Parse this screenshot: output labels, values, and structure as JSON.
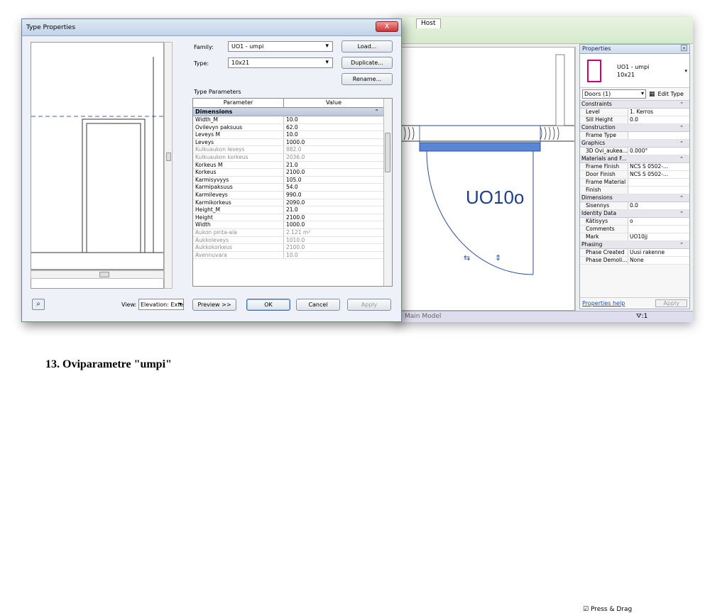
{
  "background_window": {
    "tabs": [
      "Host"
    ],
    "view_tag": "UO10o",
    "status_left": "Main Model",
    "status_right": "Press & Drag",
    "filter_count": ":1"
  },
  "properties_palette": {
    "title": "Properties",
    "type_name_line1": "UO1 - umpi",
    "type_name_line2": "10x21",
    "selector": "Doors (1)",
    "edit_type_label": "Edit Type",
    "groups": [
      {
        "name": "Constraints",
        "rows": [
          [
            "Level",
            "1. Kerros"
          ],
          [
            "Sill Height",
            "0.0"
          ]
        ]
      },
      {
        "name": "Construction",
        "rows": [
          [
            "Frame Type",
            ""
          ]
        ]
      },
      {
        "name": "Graphics",
        "rows": [
          [
            "3D Ovi_aukea...",
            "0.000°"
          ]
        ]
      },
      {
        "name": "Materials and F...",
        "rows": [
          [
            "Frame Finish",
            "NCS S 0502-..."
          ],
          [
            "Door Finish",
            "NCS S 0502-..."
          ],
          [
            "Frame Material",
            ""
          ],
          [
            "Finish",
            ""
          ]
        ]
      },
      {
        "name": "Dimensions",
        "rows": [
          [
            "Sisennys",
            "0.0"
          ]
        ]
      },
      {
        "name": "Identity Data",
        "rows": [
          [
            "Kätisyys",
            "o"
          ],
          [
            "Comments",
            ""
          ],
          [
            "Mark",
            "UO10jj"
          ]
        ]
      },
      {
        "name": "Phasing",
        "rows": [
          [
            "Phase Created",
            "Uusi rakenne"
          ],
          [
            "Phase Demoli...",
            "None"
          ]
        ]
      }
    ],
    "help_link": "Properties help",
    "apply_label": "Apply"
  },
  "dialog": {
    "title": "Type Properties",
    "close_label": "X",
    "family_label": "Family:",
    "family_value": "UO1 - umpi",
    "type_label": "Type:",
    "type_value": "10x21",
    "load_button": "Load...",
    "duplicate_button": "Duplicate...",
    "rename_button": "Rename...",
    "section_label": "Type Parameters",
    "col_parameter": "Parameter",
    "col_value": "Value",
    "group_name": "Dimensions",
    "params": [
      {
        "name": "Width_M",
        "value": "10.0",
        "readonly": false
      },
      {
        "name": "Ovilevyn paksuus",
        "value": "62.0",
        "readonly": false
      },
      {
        "name": "Leveys M",
        "value": "10.0",
        "readonly": false
      },
      {
        "name": "Leveys",
        "value": "1000.0",
        "readonly": false
      },
      {
        "name": "Kulkuaukon leveys",
        "value": "882.0",
        "readonly": true
      },
      {
        "name": "Kulkuaukon korkeus",
        "value": "2036.0",
        "readonly": true
      },
      {
        "name": "Korkeus M",
        "value": "21.0",
        "readonly": false
      },
      {
        "name": "Korkeus",
        "value": "2100.0",
        "readonly": false
      },
      {
        "name": "Karmisyvyys",
        "value": "105.0",
        "readonly": false
      },
      {
        "name": "Karmipaksuus",
        "value": "54.0",
        "readonly": false
      },
      {
        "name": "Karmileveys",
        "value": "990.0",
        "readonly": false
      },
      {
        "name": "Karmikorkeus",
        "value": "2090.0",
        "readonly": false
      },
      {
        "name": "Height_M",
        "value": "21.0",
        "readonly": false
      },
      {
        "name": "Height",
        "value": "2100.0",
        "readonly": false
      },
      {
        "name": "Width",
        "value": "1000.0",
        "readonly": false
      },
      {
        "name": "Aukon pinta-ala",
        "value": "2.121 m²",
        "readonly": true
      },
      {
        "name": "Aukkoleveys",
        "value": "1010.0",
        "readonly": true
      },
      {
        "name": "Aukkokorkeus",
        "value": "2100.0",
        "readonly": true
      },
      {
        "name": "Avennuvara",
        "value": "10.0",
        "readonly": true
      }
    ],
    "view_label": "View:",
    "view_value": "Elevation: Exterior",
    "preview_button": "Preview >>",
    "ok_button": "OK",
    "cancel_button": "Cancel",
    "apply_button": "Apply"
  },
  "caption": "13. Oviparametre \"umpi\""
}
